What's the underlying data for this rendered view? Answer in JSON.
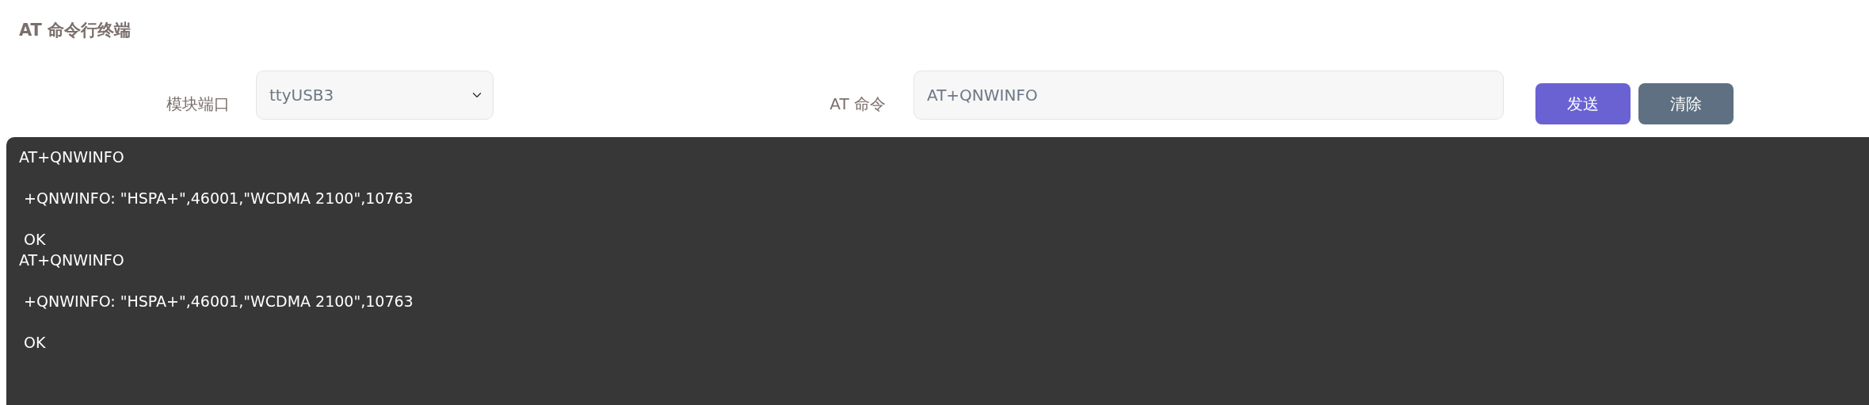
{
  "title": "AT 命令行终端",
  "port": {
    "label": "模块端口",
    "value": "ttyUSB3"
  },
  "command": {
    "label": "AT 命令",
    "value": "AT+QNWINFO"
  },
  "buttons": [
    {
      "kind": "primary",
      "label": "发送"
    },
    {
      "kind": "secondary",
      "label": "清除"
    }
  ],
  "terminal": {
    "output": "AT+QNWINFO\n\n +QNWINFO: \"HSPA+\",46001,\"WCDMA 2100\",10763\n\n OK\nAT+QNWINFO\n\n +QNWINFO: \"HSPA+\",46001,\"WCDMA 2100\",10763\n\n OK"
  }
}
